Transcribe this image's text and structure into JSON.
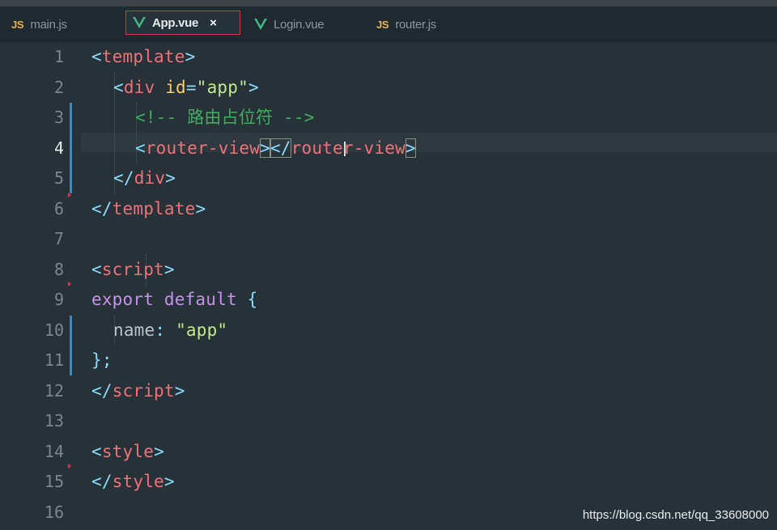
{
  "tabs": [
    {
      "label": "main.js",
      "icon": "js-icon",
      "active": false
    },
    {
      "label": "App.vue",
      "icon": "vue-icon",
      "active": true
    },
    {
      "label": "Login.vue",
      "icon": "vue-icon",
      "active": false
    },
    {
      "label": "router.js",
      "icon": "js-icon",
      "active": false
    }
  ],
  "tab_close_glyph": "×",
  "js_icon_text": "JS",
  "line_numbers": [
    "1",
    "2",
    "3",
    "4",
    "5",
    "6",
    "7",
    "8",
    "9",
    "10",
    "11",
    "12",
    "13",
    "14",
    "15",
    "16"
  ],
  "code": {
    "l1": {
      "open": "<",
      "tag": "template",
      "close": ">"
    },
    "l2": {
      "open": "<",
      "tag": "div",
      "attr": "id",
      "eq": "=",
      "val": "\"app\"",
      "close": ">"
    },
    "l3": {
      "comment": "<!-- 路由占位符 -->"
    },
    "l4": {
      "open": "<",
      "tag": "router-view",
      "close": ">",
      "open2": "</",
      "tag2": "router-view",
      "close2": ">"
    },
    "l5": {
      "open": "</",
      "tag": "div",
      "close": ">"
    },
    "l6": {
      "open": "</",
      "tag": "template",
      "close": ">"
    },
    "l8": {
      "open": "<",
      "tag": "script",
      "close": ">"
    },
    "l9": {
      "kw1": "export",
      "kw2": "default",
      "brace": "{"
    },
    "l10": {
      "key": "name",
      "colon": ":",
      "val": "\"app\""
    },
    "l11": {
      "brace": "}",
      "semi": ";"
    },
    "l12": {
      "open": "</",
      "tag": "script",
      "close": ">"
    },
    "l14": {
      "open": "<",
      "tag": "style",
      "close": ">"
    },
    "l15": {
      "open": "</",
      "tag": "style",
      "close": ">"
    }
  },
  "watermark": "https://blog.csdn.net/qq_33608000",
  "colors": {
    "background": "#263238",
    "tag": "#f07178",
    "punctuation": "#89ddff",
    "attribute": "#ffcb6b",
    "string": "#c3e88d",
    "comment": "#3fae5c",
    "keyword": "#c792ea",
    "vue": "#41b883",
    "active_tab_border": "#d23b3b",
    "git_modified": "#3b8ac4"
  }
}
